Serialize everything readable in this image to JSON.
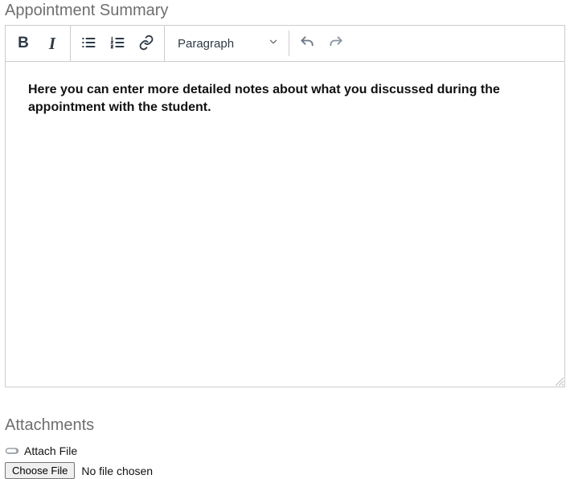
{
  "summary": {
    "title": "Appointment Summary",
    "toolbar": {
      "format_label": "Paragraph"
    },
    "content_text": "Here you can enter more detailed notes about what you discussed during the appointment with the student."
  },
  "attachments": {
    "title": "Attachments",
    "attach_label": "Attach File",
    "choose_label": "Choose File",
    "status_text": "No file chosen"
  }
}
